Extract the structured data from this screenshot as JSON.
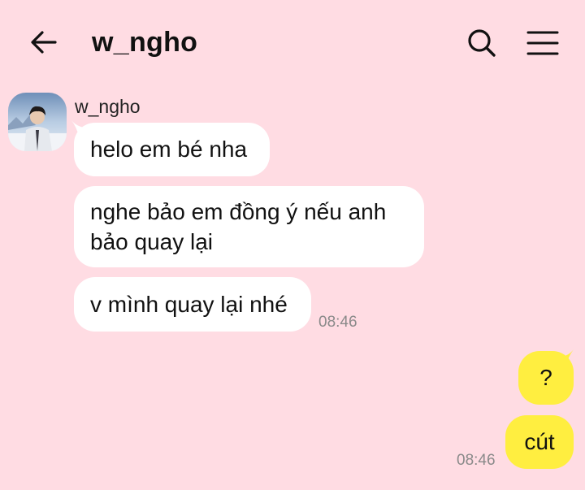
{
  "header": {
    "title": "w_ngho",
    "back_icon": "arrow-left-icon",
    "search_icon": "search-icon",
    "menu_icon": "hamburger-menu-icon"
  },
  "conversation": {
    "sender_name": "w_ngho",
    "incoming_messages": [
      {
        "text": "helo em bé nha"
      },
      {
        "text_line1": "nghe bảo em đồng ý nếu anh",
        "text_line2": "bảo quay lại"
      },
      {
        "text": "v mình quay lại nhé"
      }
    ],
    "incoming_time": "08:46",
    "outgoing_messages": [
      {
        "text": "?"
      },
      {
        "text": "cút"
      }
    ],
    "outgoing_time": "08:46"
  },
  "colors": {
    "background": "#FFDCE3",
    "incoming_bubble": "#FFFFFF",
    "outgoing_bubble": "#FFEE40"
  }
}
